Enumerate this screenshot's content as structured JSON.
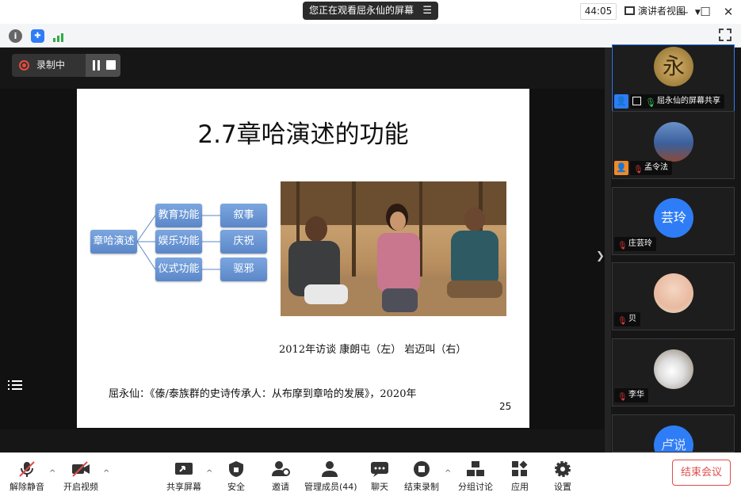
{
  "title_bar": {
    "share_banner": "您正在观看屈永仙的屏幕",
    "menu_icon": "menu-icon",
    "window_buttons": [
      "minimize-icon",
      "maximize-icon",
      "close-icon"
    ]
  },
  "info_bar": {
    "timer": "44:05",
    "view_mode": "演讲者视图"
  },
  "recording": {
    "label": "录制中"
  },
  "slide": {
    "title": "2.7章哈演述的功能",
    "diagram": {
      "root": "章哈演述",
      "functions": [
        "教育功能",
        "娱乐功能",
        "仪式功能"
      ],
      "results": [
        "叙事",
        "庆祝",
        "驱邪"
      ]
    },
    "caption": "2012年访谈 康朗屯（左）   岩迈叫（右）",
    "citation": "屈永仙：《傣/泰族群的史诗传承人：从布摩到章哈的发展》，2020年",
    "page_number": "25"
  },
  "participants": [
    {
      "name": "屈永仙的屏幕共享",
      "avatar_text": "永",
      "is_host": true
    },
    {
      "name": "孟令法",
      "avatar_text": "",
      "is_host": true
    },
    {
      "name": "庄芸玲",
      "avatar_text": "芸玲",
      "is_host": false
    },
    {
      "name": "贝",
      "avatar_text": "",
      "is_host": false
    },
    {
      "name": "李华",
      "avatar_text": "",
      "is_host": false
    },
    {
      "name": "",
      "avatar_text": "卢说",
      "is_host": false
    }
  ],
  "toolbar": {
    "unmute": "解除静音",
    "start_video": "开启视频",
    "share_screen": "共享屏幕",
    "security": "安全",
    "invite": "邀请",
    "manage_members": "管理成员(44)",
    "chat": "聊天",
    "end_recording": "结束录制",
    "breakout": "分组讨论",
    "apps": "应用",
    "settings": "设置",
    "end_meeting": "结束会议"
  },
  "colors": {
    "accent": "#2f7df6",
    "danger": "#e04b4b",
    "node": "#6a96d6"
  }
}
